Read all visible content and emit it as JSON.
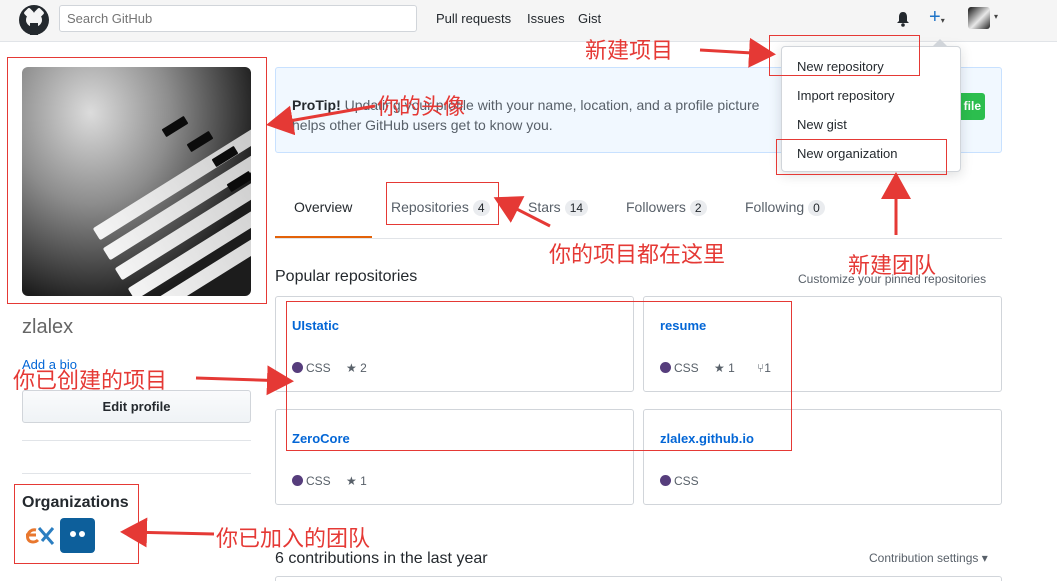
{
  "header": {
    "search_placeholder": "Search GitHub",
    "nav": [
      "Pull requests",
      "Issues",
      "Gist"
    ],
    "plus_caret": "▾",
    "avatar_caret": "▾"
  },
  "dropdown": {
    "items": [
      "New repository",
      "Import repository",
      "New gist",
      "New organization"
    ]
  },
  "profile": {
    "username": "zlalex",
    "add_bio": "Add a bio",
    "edit_profile": "Edit profile",
    "organizations_title": "Organizations"
  },
  "protip": {
    "label": "ProTip!",
    "text": " Updating your profile with your name, location, and a profile picture helps other GitHub users get to know you.",
    "button_fragment": "file"
  },
  "tabs": [
    {
      "label": "Overview",
      "count": ""
    },
    {
      "label": "Repositories",
      "count": "4"
    },
    {
      "label": "Stars",
      "count": "14"
    },
    {
      "label": "Followers",
      "count": "2"
    },
    {
      "label": "Following",
      "count": "0"
    }
  ],
  "popular": {
    "title": "Popular repositories",
    "customize": "Customize your pinned repositories"
  },
  "repos": [
    {
      "name": "UIstatic",
      "lang": "CSS",
      "stars": "2",
      "forks": ""
    },
    {
      "name": "resume",
      "lang": "CSS",
      "stars": "1",
      "forks": "1"
    },
    {
      "name": "ZeroCore",
      "lang": "CSS",
      "stars": "1",
      "forks": ""
    },
    {
      "name": "zlalex.github.io",
      "lang": "CSS",
      "stars": "",
      "forks": ""
    }
  ],
  "contributions": {
    "title": "6 contributions in the last year",
    "settings": "Contribution settings ▾"
  },
  "annotations": {
    "new_project": "新建项目",
    "your_avatar": "你的头像",
    "projects_here": "你的项目都在这里",
    "new_team": "新建团队",
    "created_projects": "你已创建的项目",
    "joined_teams": "你已加入的团队"
  },
  "colors": {
    "accent": "#0366d6",
    "annotation_red": "#e53935",
    "css_lang": "#563d7c",
    "tab_underline": "#e36209"
  }
}
